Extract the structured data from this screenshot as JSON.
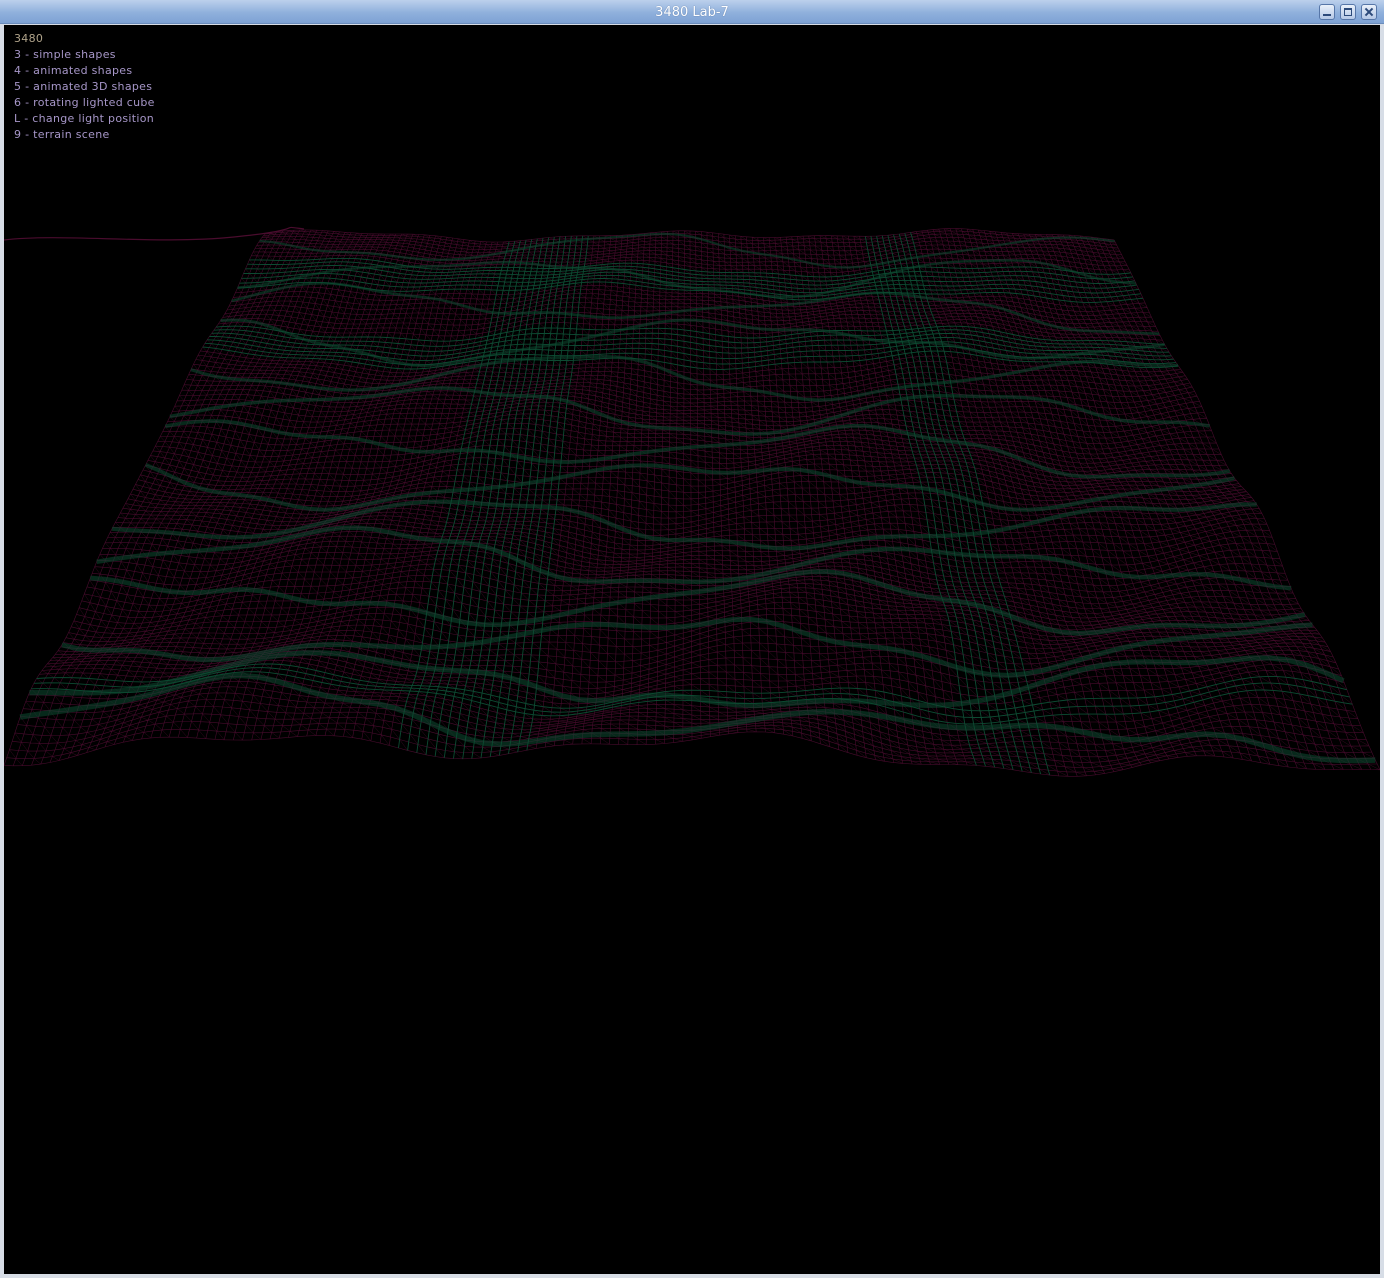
{
  "window": {
    "title": "3480 Lab-7"
  },
  "overlay": {
    "heading": "3480",
    "items": [
      "3 - simple shapes",
      "4 - animated shapes",
      "5 - animated 3D shapes",
      "6 - rotating lighted cube",
      "L - change light position",
      "9 - terrain scene"
    ]
  },
  "colors": {
    "background": "#000000",
    "wire_primary": "#4a0c2e",
    "wire_secondary": "#0d4a32",
    "heading_text": "#b0a38a",
    "item_text": "#a797c9",
    "titlebar": "#8fb0dc"
  },
  "icons": {
    "minimize": "minimize-icon",
    "maximize": "maximize-icon",
    "close": "close-icon"
  }
}
